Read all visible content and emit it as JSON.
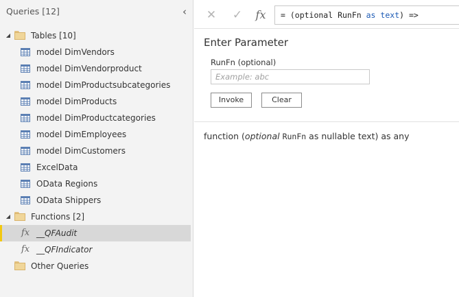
{
  "left_pane": {
    "title": "Queries [12]",
    "collapse_glyph": "‹",
    "groups": [
      {
        "label": "Tables [10]",
        "expanded": true,
        "items": [
          {
            "label": "model DimVendors",
            "icon": "table-icon"
          },
          {
            "label": "model DimVendorproduct",
            "icon": "table-icon"
          },
          {
            "label": "model DimProductsubcategories",
            "icon": "table-icon"
          },
          {
            "label": "model DimProducts",
            "icon": "table-icon"
          },
          {
            "label": "model DimProductcategories",
            "icon": "table-icon"
          },
          {
            "label": "model DimEmployees",
            "icon": "table-icon"
          },
          {
            "label": "model DimCustomers",
            "icon": "table-icon"
          },
          {
            "label": "ExcelData",
            "icon": "table-icon"
          },
          {
            "label": "OData Regions",
            "icon": "table-icon"
          },
          {
            "label": "OData Shippers",
            "icon": "table-icon"
          }
        ]
      },
      {
        "label": "Functions [2]",
        "expanded": true,
        "items": [
          {
            "label": "__QFAudit",
            "icon": "function-icon",
            "selected": true
          },
          {
            "label": "__QFIndicator",
            "icon": "function-icon",
            "selected": false
          }
        ]
      },
      {
        "label": "Other Queries",
        "expanded": false,
        "items": []
      }
    ]
  },
  "formula_bar": {
    "cancel_glyph": "✕",
    "commit_glyph": "✓",
    "fx_glyph": "fx",
    "prefix": "= (optional RunFn ",
    "as_kw": "as",
    "space": " ",
    "type_kw": "text",
    "suffix": ") =>"
  },
  "parameter": {
    "title": "Enter Parameter",
    "label": "RunFn (optional)",
    "placeholder": "Example: abc",
    "invoke_label": "Invoke",
    "clear_label": "Clear"
  },
  "description": {
    "part1": "function (",
    "optional": "optional",
    "space": " ",
    "param": "RunFn",
    "part2": " as nullable text) as any"
  },
  "colors": {
    "selection_accent": "#f2c811",
    "keyword": "#1d5bb5"
  }
}
